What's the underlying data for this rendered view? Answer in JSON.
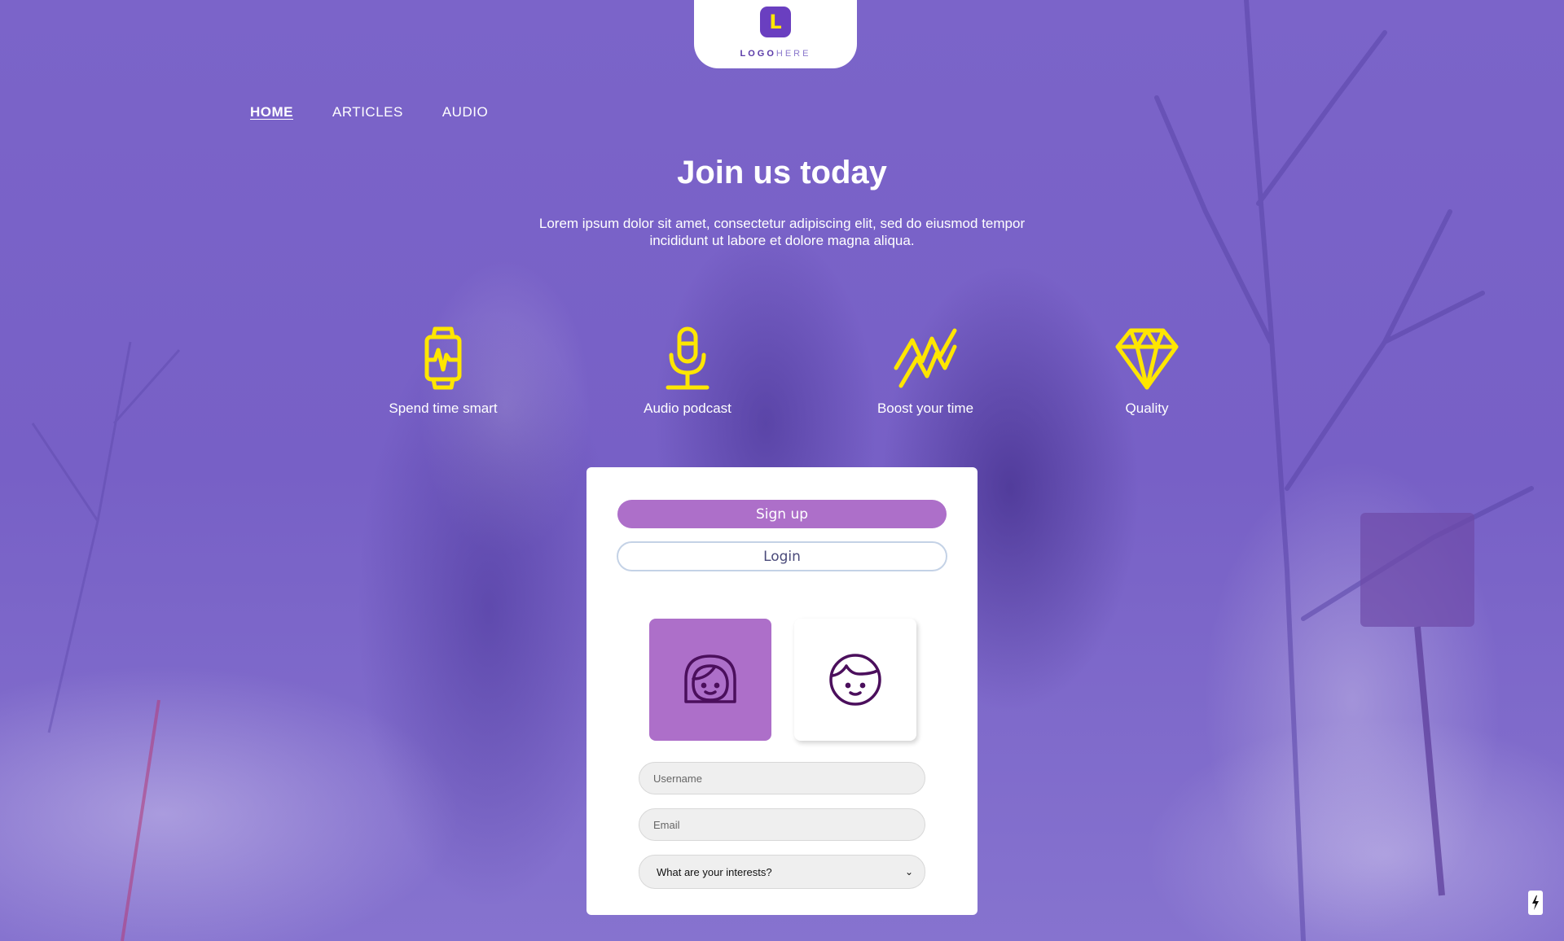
{
  "logo": {
    "mark": "L",
    "text_bold": "LOGO",
    "text_light": "HERE"
  },
  "nav": [
    {
      "label": "HOME",
      "active": true
    },
    {
      "label": "ARTICLES",
      "active": false
    },
    {
      "label": "AUDIO",
      "active": false
    }
  ],
  "hero": {
    "title": "Join us today",
    "subtitle": "Lorem ipsum dolor sit amet, consectetur adipiscing elit, sed do eiusmod tempor incididunt ut labore et dolore magna aliqua."
  },
  "features": [
    {
      "icon": "smartwatch-icon",
      "label": "Spend time smart"
    },
    {
      "icon": "microphone-icon",
      "label": "Audio podcast"
    },
    {
      "icon": "trend-lines-icon",
      "label": "Boost your time"
    },
    {
      "icon": "diamond-icon",
      "label": "Quality"
    }
  ],
  "card": {
    "signup_label": "Sign up",
    "login_label": "Login",
    "avatars": [
      {
        "icon": "female-avatar-icon",
        "selected": true
      },
      {
        "icon": "male-avatar-icon",
        "selected": false
      }
    ],
    "username_placeholder": "Username",
    "email_placeholder": "Email",
    "interests_selected": "What are your interests?"
  },
  "colors": {
    "overlay": "#7a63c8",
    "accent": "#ad6fc9",
    "icon_yellow": "#ffe600",
    "avatar_stroke": "#4b0f5c"
  }
}
